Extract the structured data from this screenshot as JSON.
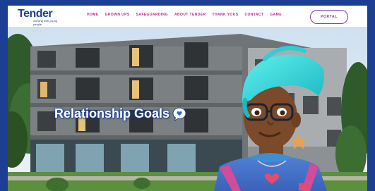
{
  "brand": {
    "logo_text": "Tender",
    "logo_tagline": "working with young people",
    "primary_color": "#1d3f93",
    "accent_color": "#c2278c"
  },
  "nav": {
    "links": [
      "HOME",
      "GROWN UPS",
      "SAFEGUARDING",
      "ABOUT TENDER",
      "THANK YOUS",
      "CONTACT",
      "GAME"
    ],
    "portal_label": "PORTAL"
  },
  "hero": {
    "headline": "Relationship Goals",
    "headline_icon": "speech-bubble-heart-icon",
    "character": "animated-girl-teal-hair"
  }
}
